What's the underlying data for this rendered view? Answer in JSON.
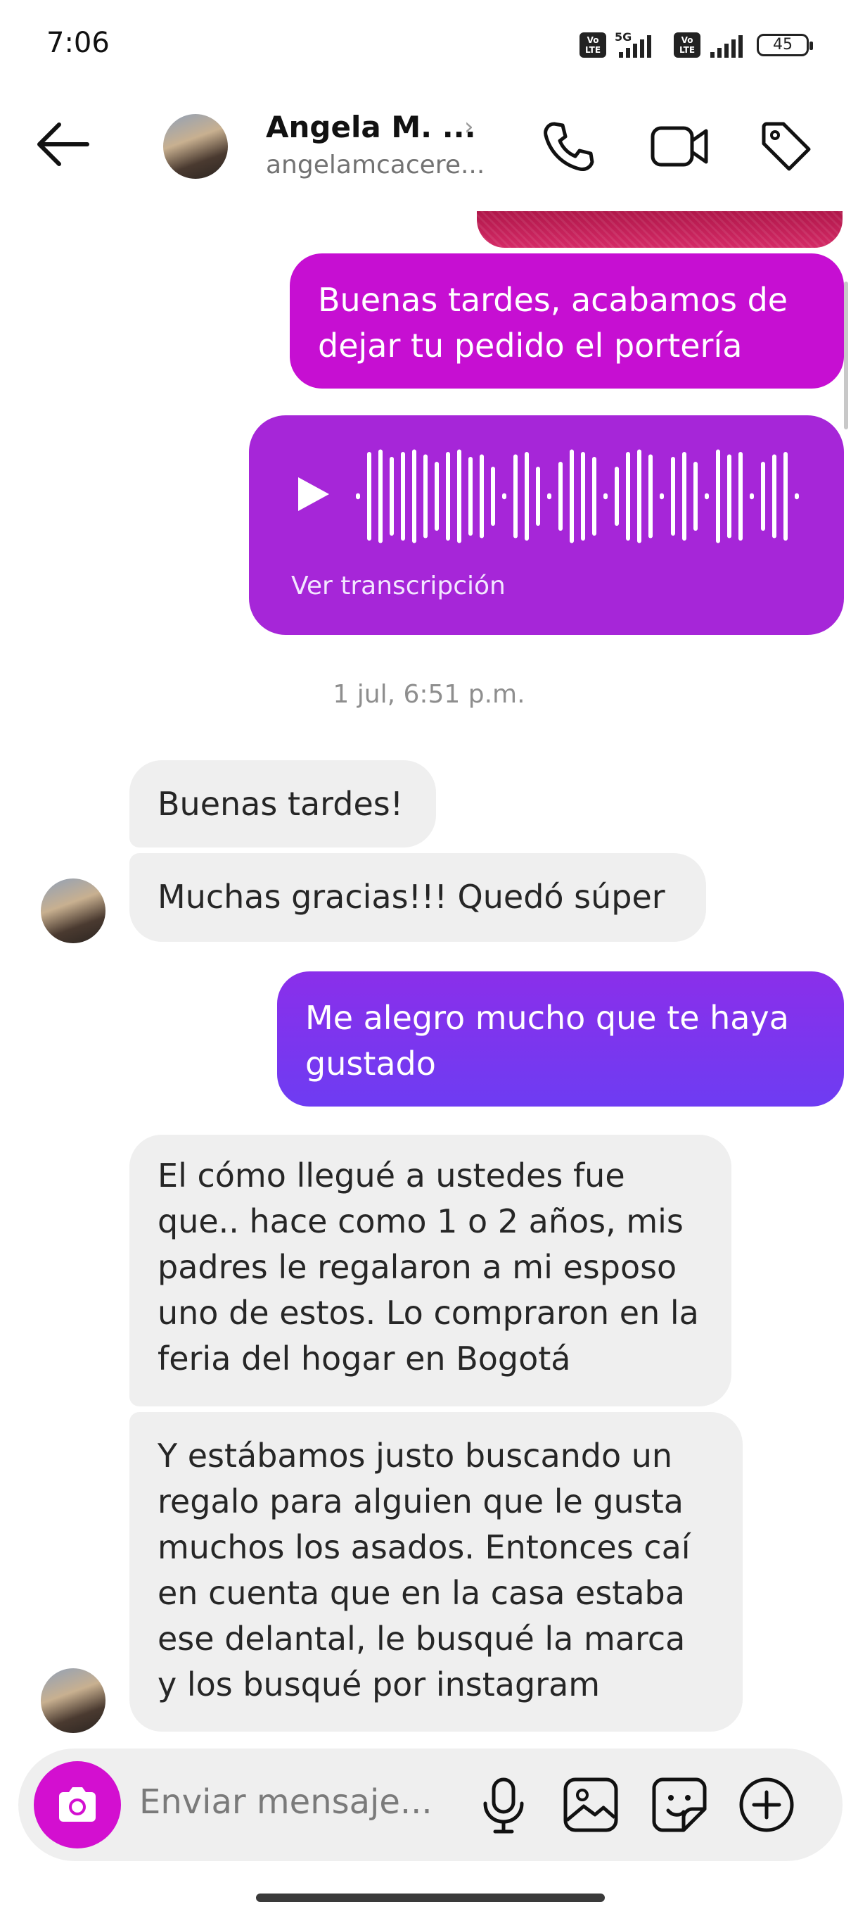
{
  "status_bar": {
    "time": "7:06",
    "network": "5G",
    "battery": "45"
  },
  "header": {
    "name": "Angela M. ...",
    "username": "angelamcacere..."
  },
  "messages": [
    {
      "from": "me",
      "text": "Buenas tardes, acabamos de dejar tu pedido el portería"
    },
    {
      "from": "me",
      "type": "voice",
      "transcript_link": "Ver transcripción"
    },
    {
      "from": "them",
      "text": "Buenas tardes!"
    },
    {
      "from": "them",
      "text": "Muchas gracias!!! Quedó súper"
    },
    {
      "from": "me",
      "text": "Me alegro mucho que te haya gustado"
    },
    {
      "from": "them",
      "text": "El cómo llegué a ustedes fue que.. hace como 1 o 2 años, mis padres le regalaron a mi esposo uno de estos. Lo compraron en la feria del hogar en Bogotá"
    },
    {
      "from": "them",
      "text": "Y estábamos justo buscando un regalo para alguien que le gusta muchos los asados. Entonces caí en cuenta que en la casa estaba ese delantal, le busqué la marca y los busqué por instagram"
    }
  ],
  "timestamp": "1 jul, 6:51 p.m.",
  "composer": {
    "placeholder": "Enviar mensaje..."
  },
  "colors": {
    "out_pink": "#c60fd2",
    "out_purple_voice": "#a626d8",
    "out_violet": "#7a35f0",
    "in_bubble": "#efefef",
    "camera": "#d30fd0"
  },
  "icons": [
    "back-arrow-icon",
    "phone-icon",
    "video-call-icon",
    "tag-icon",
    "play-icon",
    "camera-icon",
    "microphone-icon",
    "gallery-icon",
    "sticker-icon",
    "plus-icon"
  ]
}
